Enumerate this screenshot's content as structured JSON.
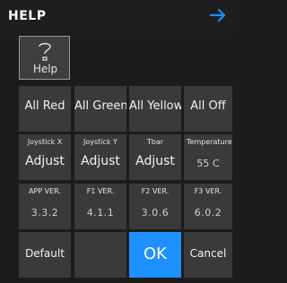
{
  "header": {
    "title": "HELP",
    "back_icon": "arrow-right-icon",
    "accent": "#1e90ff"
  },
  "help_button": {
    "icon": "question-mark-icon",
    "label": "Help"
  },
  "row1": [
    "All Red",
    "All Green",
    "All Yellow",
    "All Off"
  ],
  "adjust_row": [
    {
      "label": "Joystick X",
      "value": "Adjust"
    },
    {
      "label": "Joystick Y",
      "value": "Adjust"
    },
    {
      "label": "Tbar",
      "value": "Adjust"
    },
    {
      "label": "Temperature",
      "value": "55 C"
    }
  ],
  "version_row": [
    {
      "label": "APP VER.",
      "value": "3.3.2"
    },
    {
      "label": "F1 VER.",
      "value": "4.1.1"
    },
    {
      "label": "F2 VER.",
      "value": "3.0.6"
    },
    {
      "label": "F3 VER.",
      "value": "6.0.2"
    }
  ],
  "bottom_row": {
    "default_label": "Default",
    "ok_label": "OK",
    "cancel_label": "Cancel"
  }
}
